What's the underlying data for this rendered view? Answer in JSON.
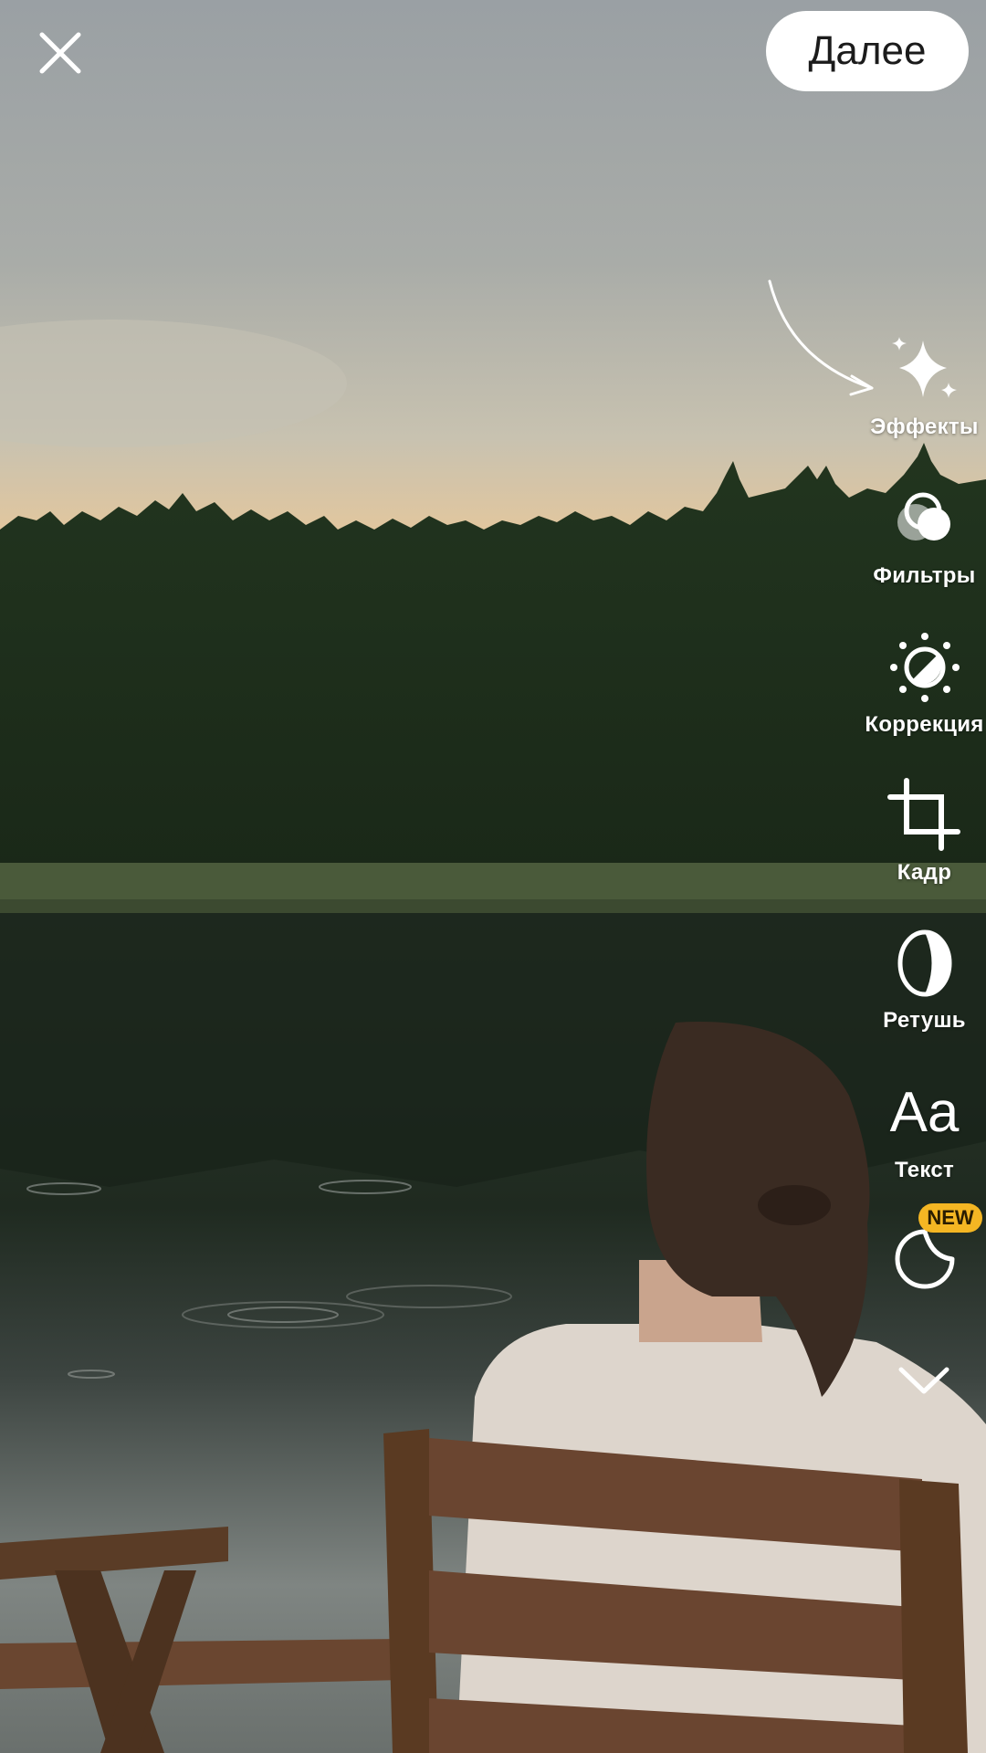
{
  "header": {
    "close_icon": "close-icon",
    "next_label": "Далее"
  },
  "tools": [
    {
      "label": "Эффекты",
      "icon": "sparkles-icon"
    },
    {
      "label": "Фильтры",
      "icon": "filters-icon"
    },
    {
      "label": "Коррекция",
      "icon": "adjust-icon"
    },
    {
      "label": "Кадр",
      "icon": "crop-icon"
    },
    {
      "label": "Ретушь",
      "icon": "retouch-icon"
    },
    {
      "label": "Текст",
      "icon": "text-icon"
    },
    {
      "label": "",
      "icon": "sticker-icon",
      "badge": "NEW"
    }
  ],
  "more_icon": "chevron-down-icon",
  "colors": {
    "accent_badge": "#f4b623",
    "button_bg": "#ffffff"
  }
}
